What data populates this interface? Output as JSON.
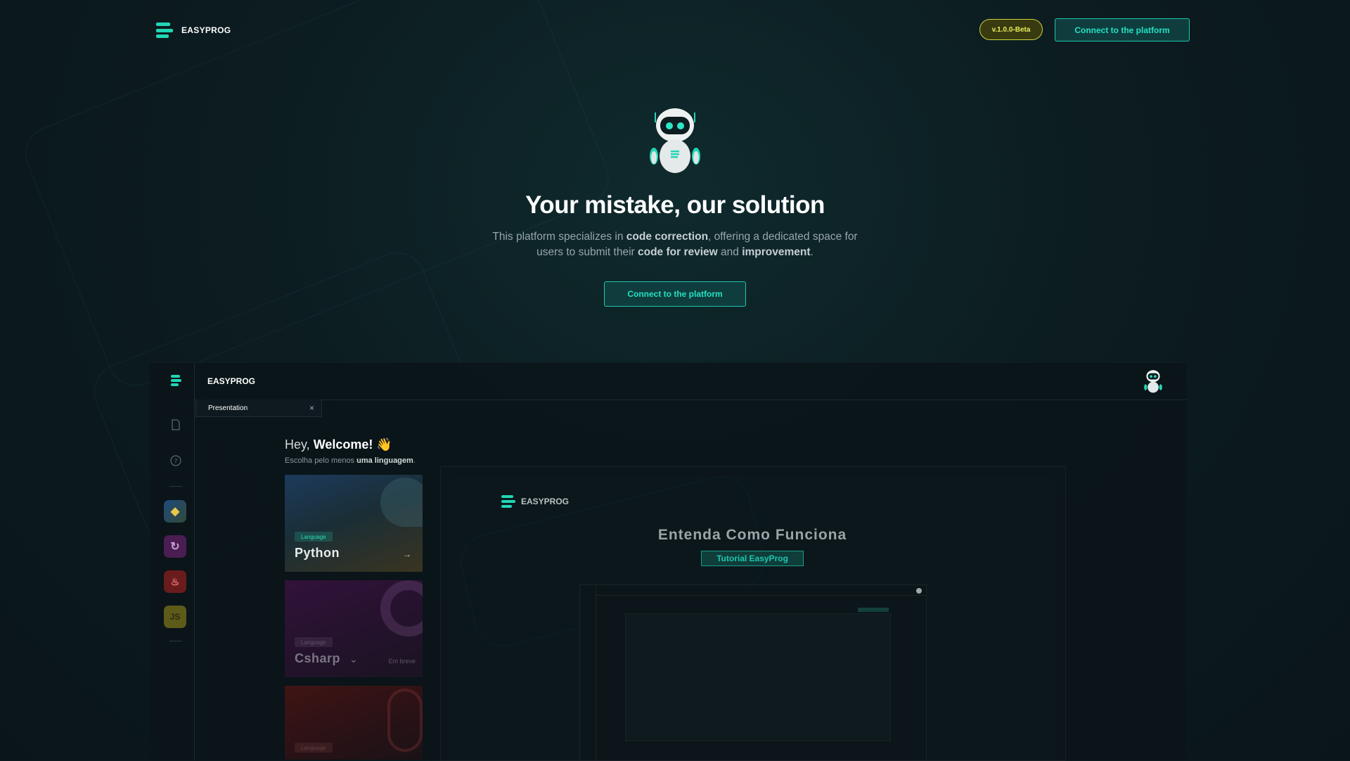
{
  "nav": {
    "brand": "EASYPROG",
    "version_badge": "v.1.0.0-Beta",
    "connect_label": "Connect  to the platform"
  },
  "hero": {
    "title": "Your mistake, our solution",
    "desc_1": "This platform specializes in ",
    "desc_bold_1": "code correction",
    "desc_2": ", offering a dedicated space for users to submit their ",
    "desc_bold_2": "code for review",
    "desc_3": " and ",
    "desc_bold_3": "improvement",
    "desc_4": ".",
    "cta_label": "Connect to the platform"
  },
  "app": {
    "brand": "EASYPROG",
    "tab_label": "Presentation",
    "tab_close": "×",
    "greeting_prefix": "Hey, ",
    "greeting_bold": "Welcome!",
    "greeting_emoji": "👋",
    "subtitle_prefix": "Escolha pelo menos ",
    "subtitle_bold": "uma linguagem",
    "subtitle_suffix": ".",
    "sidebar_js_label": "JS",
    "cards": [
      {
        "tag": "Language",
        "name": "Python",
        "arrow": "→"
      },
      {
        "tag": "Language",
        "name": "Csharp",
        "chevron": "⌄",
        "status": "Em breve"
      },
      {
        "tag": "Language"
      }
    ]
  },
  "preview": {
    "brand": "EASYPROG",
    "title": "Entenda Como Funciona",
    "button_label": "Tutorial EasyProg"
  },
  "colors": {
    "accent": "#21d6b5",
    "badge": "#e7ee5a",
    "background": "#0c1c20"
  }
}
